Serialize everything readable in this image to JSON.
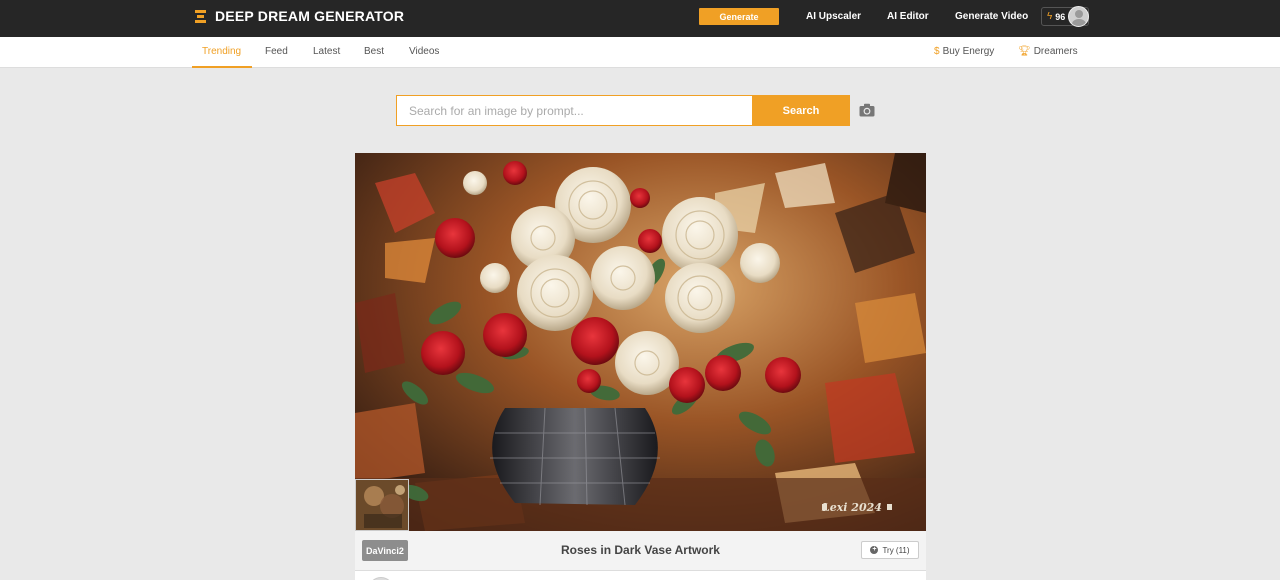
{
  "brand": {
    "name": "DEEP DREAM GENERATOR",
    "accent": "#f0a025",
    "topbar_bg": "#262626"
  },
  "topbar": {
    "generate_label": "Generate",
    "nav": [
      "AI Upscaler",
      "AI Editor",
      "Generate Video"
    ],
    "energy_count": "96",
    "avatar_icon": "user-avatar"
  },
  "subnav": {
    "tabs": [
      "Trending",
      "Feed",
      "Latest",
      "Best",
      "Videos"
    ],
    "active_tab": "Trending",
    "buy_energy": "Buy Energy",
    "dreamers": "Dreamers"
  },
  "search": {
    "placeholder": "Search for an image by prompt...",
    "value": "",
    "button_label": "Search",
    "camera_icon": "camera-icon"
  },
  "artwork": {
    "signature": "Lexi 2024"
  },
  "caption": {
    "model": "DaVinci2",
    "title": "Roses in Dark Vase Artwork",
    "try_label": "Try (11)"
  }
}
